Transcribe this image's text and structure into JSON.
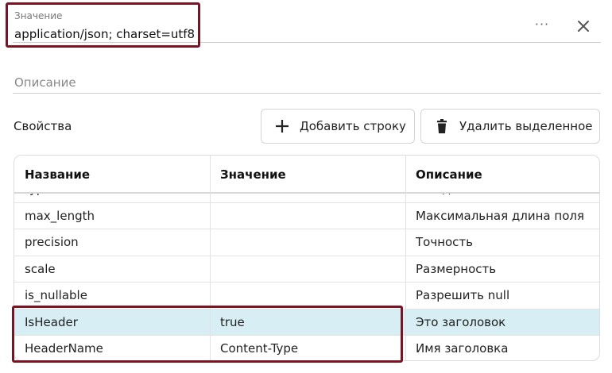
{
  "value_field": {
    "label": "Значение",
    "value": "application/json; charset=utf8"
  },
  "header_actions": {
    "more": "···"
  },
  "description_field": {
    "label": "Описание"
  },
  "properties": {
    "label": "Свойства",
    "add_button": "Добавить строку",
    "delete_button": "Удалить выделенное"
  },
  "table": {
    "columns": [
      "Название",
      "Значение",
      "Описание"
    ],
    "rows": [
      {
        "name": "type",
        "value": "",
        "description": "Тип данных"
      },
      {
        "name": "max_length",
        "value": "",
        "description": "Максимальная длина поля"
      },
      {
        "name": "precision",
        "value": "",
        "description": "Точность"
      },
      {
        "name": "scale",
        "value": "",
        "description": "Размерность"
      },
      {
        "name": "is_nullable",
        "value": "",
        "description": "Разрешить null"
      },
      {
        "name": "IsHeader",
        "value": "true",
        "description": "Это заголовок"
      },
      {
        "name": "HeaderName",
        "value": "Content-Type",
        "description": "Имя заголовка"
      }
    ],
    "selected_row_index": 5
  },
  "colors": {
    "highlight_border": "#7a1424",
    "selected_row": "#d6eef4"
  },
  "icons": {
    "more": "more-horizontal-icon",
    "close": "close-icon",
    "add": "plus-icon",
    "delete": "trash-icon"
  }
}
